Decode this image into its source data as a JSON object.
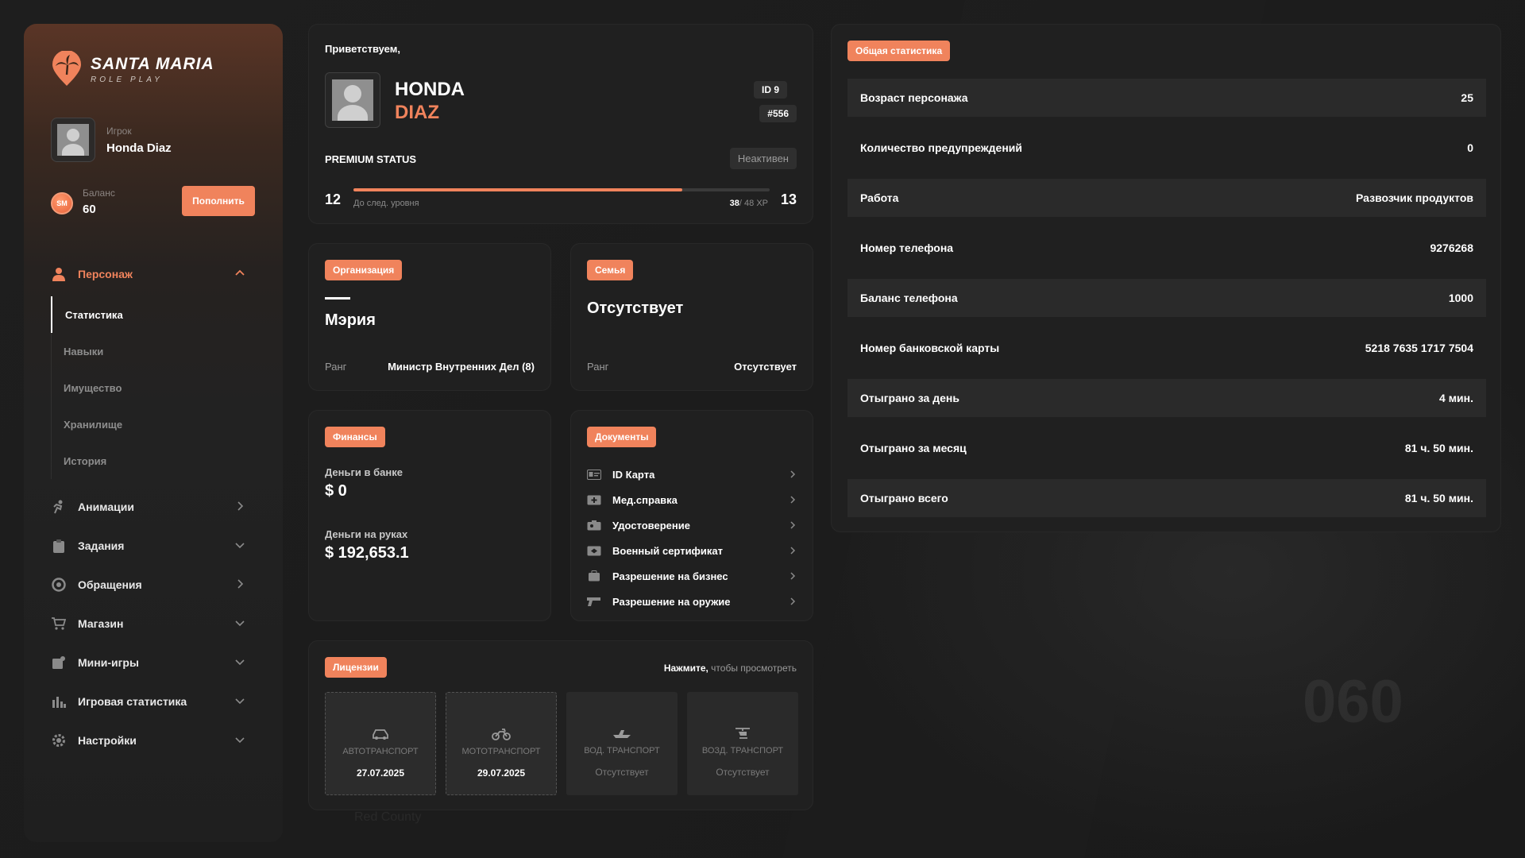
{
  "brand": {
    "title": "SANTA MARIA",
    "subtitle": "ROLE PLAY"
  },
  "player": {
    "label": "Игрок",
    "name": "Honda Diaz"
  },
  "balance": {
    "label": "Баланс",
    "value": "60",
    "coin": "SM",
    "topup_label": "Пополнить"
  },
  "menu": {
    "character": "Персонаж",
    "sub": [
      "Статистика",
      "Навыки",
      "Имущество",
      "Хранилище",
      "История"
    ],
    "items": [
      "Анимации",
      "Задания",
      "Обращения",
      "Магазин",
      "Мини-игры",
      "Игровая статистика",
      "Настройки"
    ]
  },
  "profile": {
    "welcome": "Приветствуем,",
    "first_name": "HONDA",
    "last_name": "DIAZ",
    "id": "ID 9",
    "number": "#556",
    "premium_label": "PREMIUM STATUS",
    "premium_state": "Неактивен",
    "level_current": "12",
    "level_next": "13",
    "xp_hint": "До след. уровня",
    "xp_current": "38",
    "xp_total": "/ 48 XP",
    "xp_fraction": 0.79
  },
  "organization": {
    "tag": "Организация",
    "name": "Мэрия",
    "rank_label": "Ранг",
    "rank": "Министр Внутренних Дел (8)"
  },
  "family": {
    "tag": "Семья",
    "name": "Отсутствует",
    "rank_label": "Ранг",
    "rank": "Отсутствует"
  },
  "finance": {
    "tag": "Финансы",
    "bank_label": "Деньги в банке",
    "bank_value": "$ 0",
    "cash_label": "Деньги на руках",
    "cash_value": "$ 192,653.1"
  },
  "documents": {
    "tag": "Документы",
    "items": [
      "ID Карта",
      "Мед.справка",
      "Удостоверение",
      "Военный сертификат",
      "Разрешение на бизнес",
      "Разрешение на оружие"
    ]
  },
  "licenses": {
    "tag": "Лицензии",
    "hint_bold": "Нажмите,",
    "hint_rest": " чтобы просмотреть",
    "items": [
      {
        "name": "АВТОТРАНСПОРТ",
        "value": "27.07.2025"
      },
      {
        "name": "МОТОТРАНСПОРТ",
        "value": "29.07.2025"
      },
      {
        "name": "ВОД. ТРАНСПОРТ",
        "value": "Отсутствует"
      },
      {
        "name": "ВОЗД. ТРАНСПОРТ",
        "value": "Отсутствует"
      }
    ]
  },
  "stats": {
    "tag": "Общая статистика",
    "rows": [
      {
        "label": "Возраст персонажа",
        "value": "25"
      },
      {
        "label": "Количество предупреждений",
        "value": "0"
      },
      {
        "label": "Работа",
        "value": "Развозчик продуктов"
      },
      {
        "label": "Номер телефона",
        "value": "9276268"
      },
      {
        "label": "Баланс телефона",
        "value": "1000"
      },
      {
        "label": "Номер банковской карты",
        "value": "5218 7635 1717 7504"
      },
      {
        "label": "Отыграно за день",
        "value": "4 мин."
      },
      {
        "label": "Отыграно за месяц",
        "value": "81 ч. 50 мин."
      },
      {
        "label": "Отыграно всего",
        "value": "81 ч. 50 мин."
      }
    ]
  },
  "background": {
    "speed": "060",
    "location": "Red County"
  },
  "colors": {
    "accent": "#f0835c",
    "card": "#202020",
    "row": "#2a2a2a"
  }
}
